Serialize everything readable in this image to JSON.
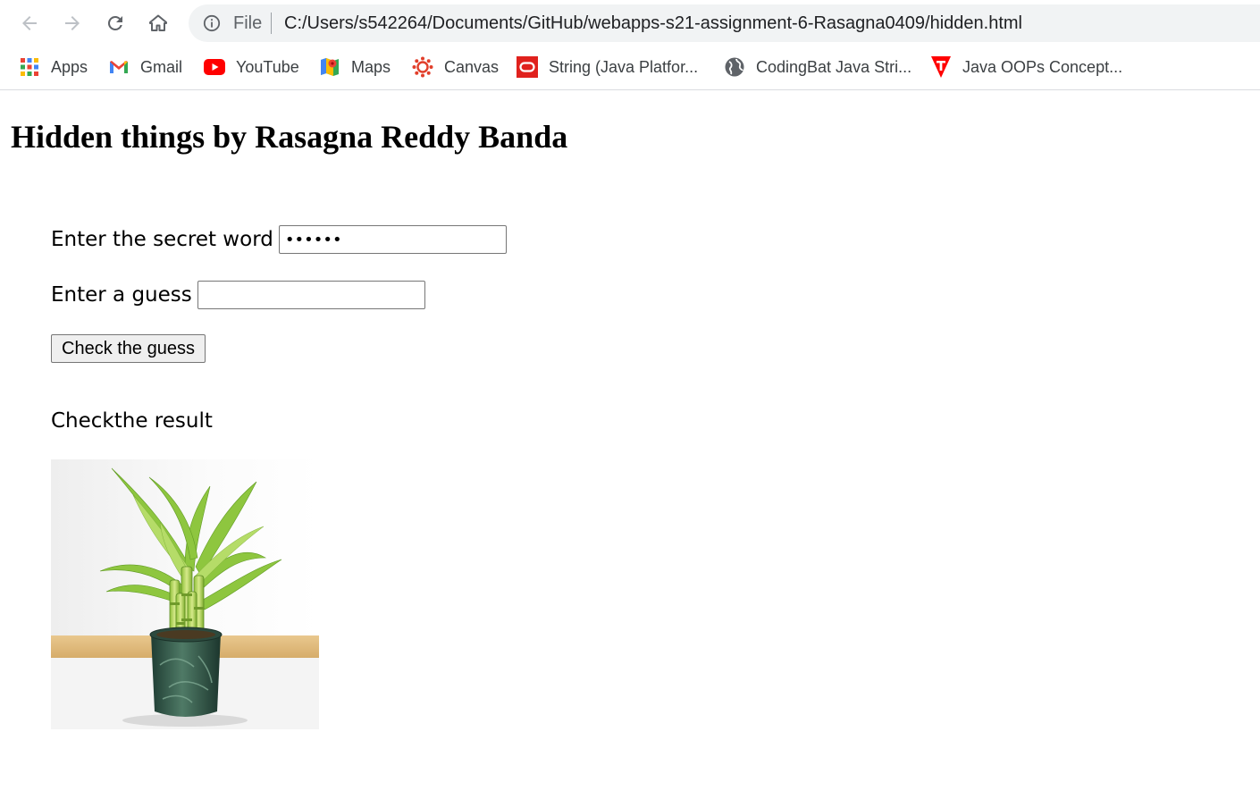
{
  "browser": {
    "nav": {
      "back_icon": "arrow-left-icon",
      "forward_icon": "arrow-right-icon",
      "reload_icon": "reload-icon",
      "home_icon": "home-icon"
    },
    "address_bar": {
      "scheme_label": "File",
      "url": "C:/Users/s542264/Documents/GitHub/webapps-s21-assignment-6-Rasagna0409/hidden.html"
    },
    "bookmarks": [
      {
        "label": "Apps",
        "icon": "apps-grid-icon"
      },
      {
        "label": "Gmail",
        "icon": "gmail-icon"
      },
      {
        "label": "YouTube",
        "icon": "youtube-icon"
      },
      {
        "label": "Maps",
        "icon": "maps-icon"
      },
      {
        "label": "Canvas",
        "icon": "canvas-icon"
      },
      {
        "label": "String (Java Platfor...",
        "icon": "oracle-icon"
      },
      {
        "label": "CodingBat Java Stri...",
        "icon": "globe-icon"
      },
      {
        "label": "Java OOPs Concept...",
        "icon": "javatpoint-icon"
      }
    ]
  },
  "page": {
    "title": "Hidden things by Rasagna Reddy Banda",
    "secret_word": {
      "label": "Enter the secret word",
      "value": "••••••"
    },
    "guess": {
      "label": "Enter a guess",
      "value": ""
    },
    "check_button": "Check the guess",
    "result_text": "Checkthe result",
    "image": {
      "subject": "lucky bamboo in green ceramic pot"
    }
  },
  "colors": {
    "omnibox_bg": "#f1f3f4",
    "button_bg": "#efefef",
    "input_border": "#767676",
    "youtube_red": "#ff0000",
    "canvas_red": "#e13f2b",
    "oracle_red": "#e0211d"
  }
}
